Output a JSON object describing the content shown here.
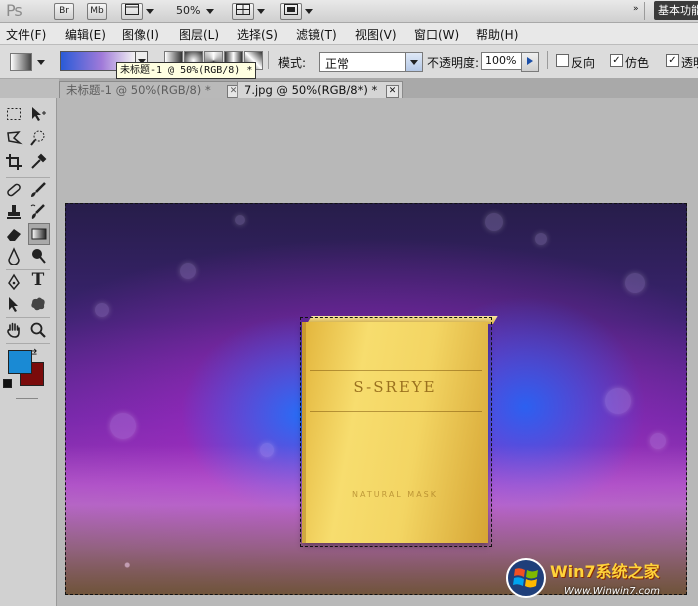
{
  "app": {
    "logo": "Ps",
    "bridge_label": "Br",
    "minibridge_label": "Mb",
    "zoom_value": "50%",
    "workspace_label": "基本功能"
  },
  "menu": {
    "items": [
      "文件(F)",
      "编辑(E)",
      "图像(I)",
      "图层(L)",
      "选择(S)",
      "滤镜(T)",
      "视图(V)",
      "窗口(W)",
      "帮助(H)"
    ]
  },
  "options": {
    "tooltip": "未标题-1 @ 50%(RGB/8) *",
    "mode_label": "模式:",
    "mode_value": "正常",
    "opacity_label": "不透明度:",
    "opacity_value": "100%",
    "reverse_label": "反向",
    "dither_label": "仿色",
    "transparency_label": "透明",
    "reverse_checked": false,
    "dither_checked": true,
    "transparency_checked": true
  },
  "tabs": [
    {
      "label": "未标题-1 @ 50%(RGB/8) *",
      "active": false
    },
    {
      "label": "7.jpg @ 50%(RGB/8*) *",
      "active": true
    }
  ],
  "tools": {
    "foreground_color": "#1a8ad4",
    "background_color": "#7a0b0b"
  },
  "canvas": {
    "product_brand": "S-SREYE",
    "product_subtext": "NATURAL MASK"
  },
  "watermark": {
    "title": "Win7系统之家",
    "url": "Www.Winwin7.com"
  }
}
